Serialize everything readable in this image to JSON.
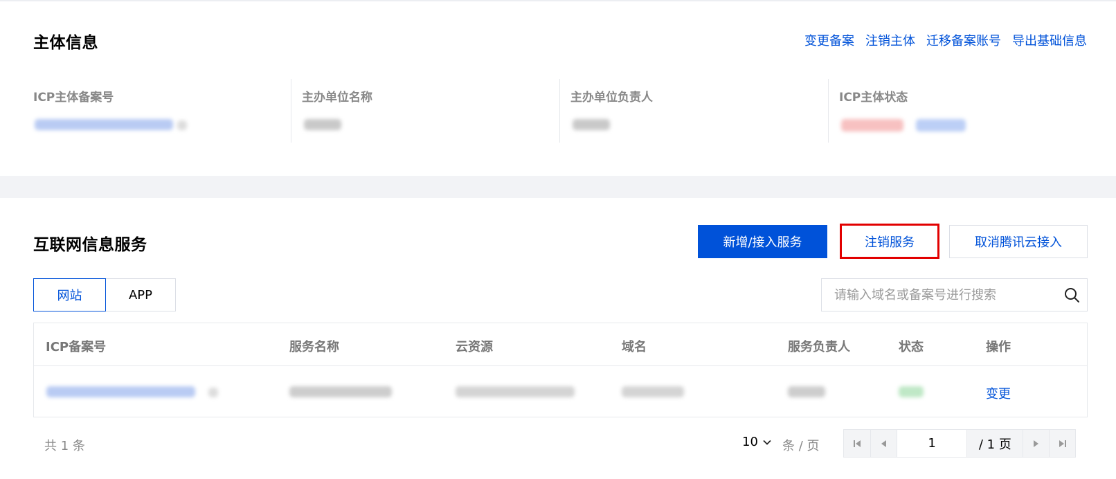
{
  "subject_section": {
    "title": "主体信息",
    "actions": [
      "变更备案",
      "注销主体",
      "迁移备案账号",
      "导出基础信息"
    ],
    "fields": [
      {
        "label": "ICP主体备案号"
      },
      {
        "label": "主办单位名称"
      },
      {
        "label": "主办单位负责人"
      },
      {
        "label": "ICP主体状态"
      }
    ]
  },
  "service_section": {
    "title": "互联网信息服务",
    "buttons": {
      "add_service": "新增/接入服务",
      "cancel_service": "注销服务",
      "cancel_access": "取消腾讯云接入"
    },
    "tabs": [
      "网站",
      "APP"
    ],
    "active_tab": "网站",
    "search": {
      "placeholder": "请输入域名或备案号进行搜索",
      "value": ""
    },
    "table": {
      "columns": [
        "ICP备案号",
        "服务名称",
        "云资源",
        "域名",
        "服务负责人",
        "状态",
        "操作"
      ],
      "rows": [
        {
          "action": "变更"
        }
      ]
    }
  },
  "pagination": {
    "total_text": "共 1 条",
    "page_size": "10",
    "per_page_text": "条 / 页",
    "current_page": "1",
    "total_pages_text": "/ 1 页"
  },
  "colors": {
    "primary": "#0052d9",
    "highlight_border": "#e20000",
    "divider": "#e6e8ec",
    "band": "#f2f3f6"
  }
}
